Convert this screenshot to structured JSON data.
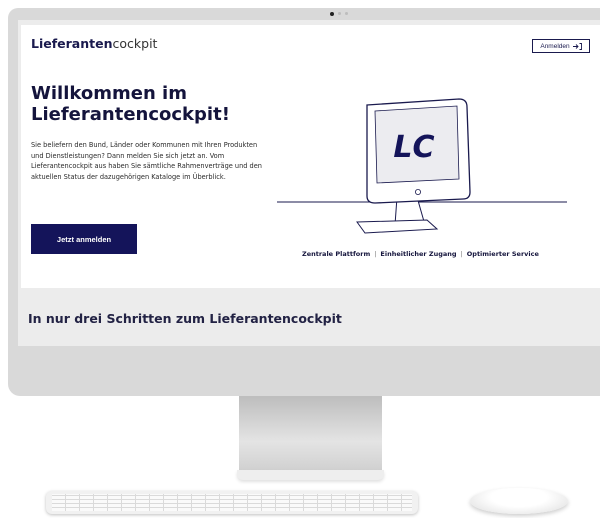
{
  "header": {
    "logo_bold": "Lieferanten",
    "logo_light": "cockpit",
    "login_label": "Anmelden",
    "login_icon": "login-arrow-icon"
  },
  "hero": {
    "title": "Willkommen im Lieferantencockpit!",
    "intro": "Sie beliefern den Bund, Länder oder Kommunen mit Ihren Produkten und Dienstleistungen? Dann melden Sie sich jetzt an. Vom Lieferantencockpit aus haben Sie sämtliche Rahmenverträge und den aktuellen Status der dazugehörigen Kataloge im Überblick.",
    "cta_label": "Jetzt anmelden",
    "illustration_text": "LC"
  },
  "tagline": {
    "item1": "Zentrale Plattform",
    "item2": "Einheitlicher Zugang",
    "item3": "Optimierter Service",
    "separator": "|"
  },
  "section": {
    "title": "In nur drei Schritten zum Lieferantencockpit"
  },
  "colors": {
    "brand_navy": "#14145a",
    "text_dark": "#14143c"
  }
}
